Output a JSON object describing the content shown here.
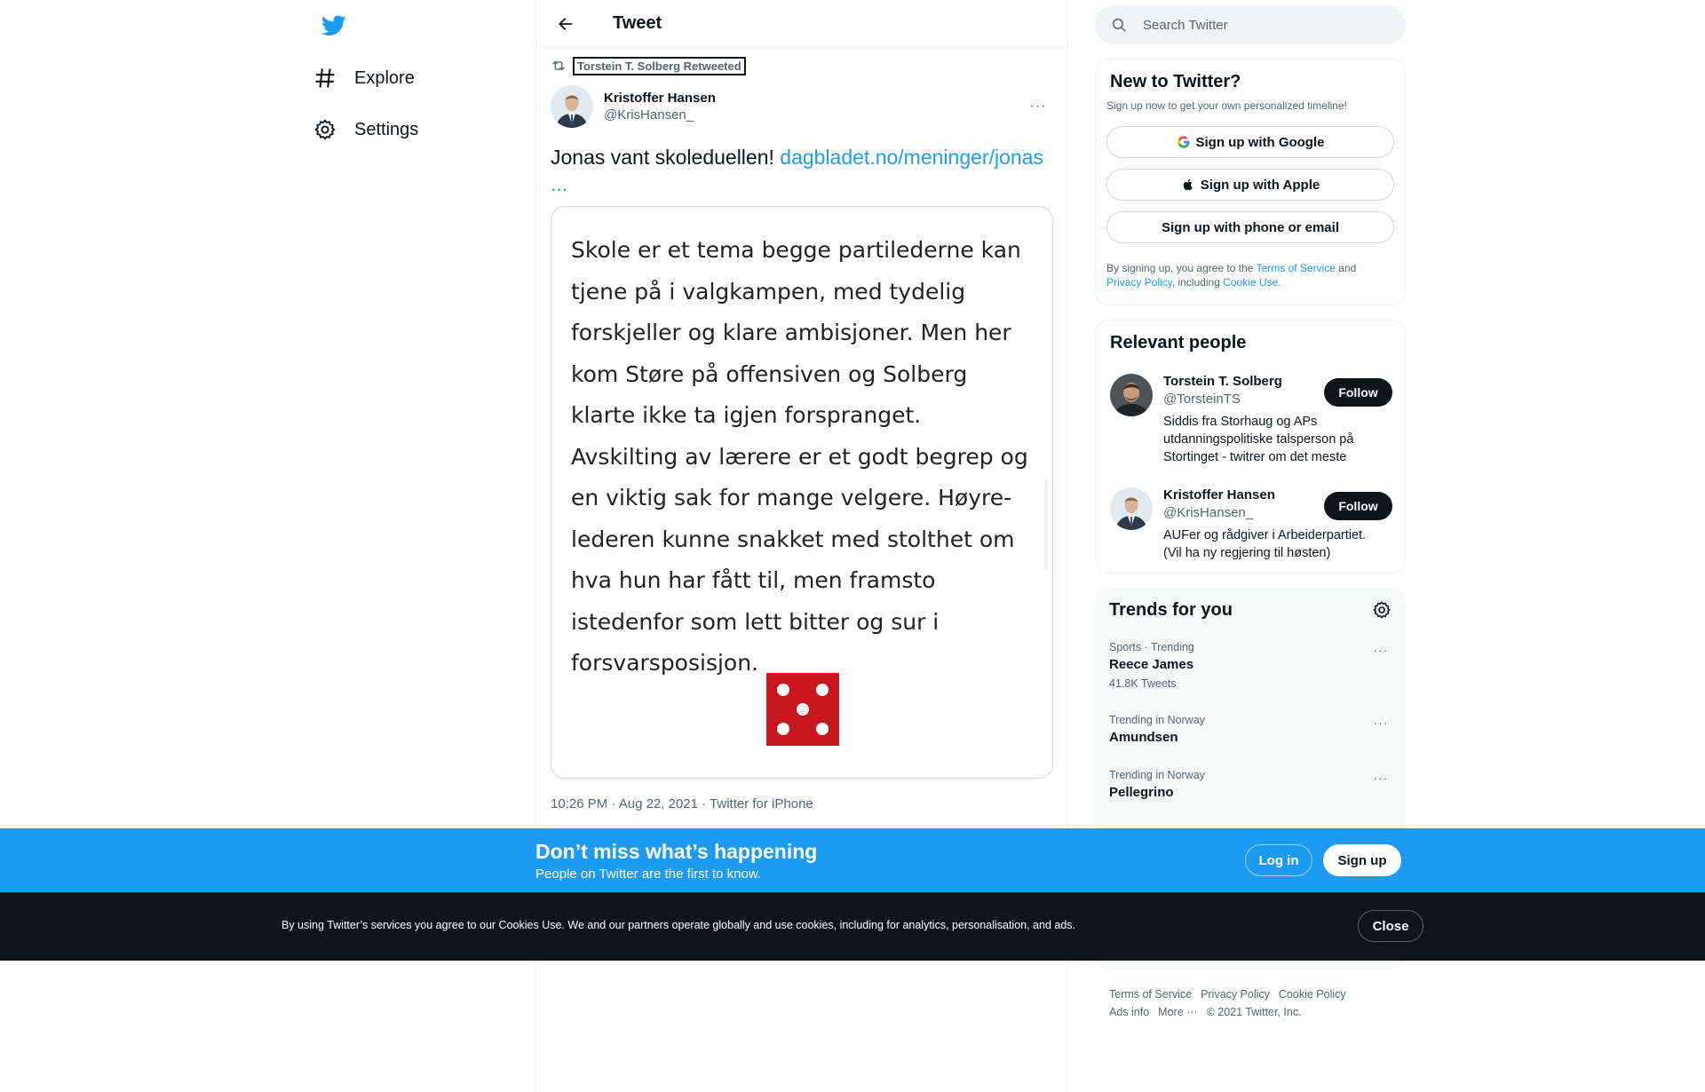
{
  "colors": {
    "accent": "#1d9bf0",
    "text": "#0f1419",
    "muted": "#536471",
    "dark": "#0f1419",
    "border": "#eff3f4"
  },
  "nav": {
    "logo_icon": "twitter-bird-icon",
    "items": [
      {
        "label": "Explore",
        "icon": "hashtag-icon"
      },
      {
        "label": "Settings",
        "icon": "gear-icon"
      }
    ]
  },
  "header": {
    "title": "Tweet",
    "back_icon": "arrow-left-icon"
  },
  "tweet": {
    "retweeted_by": "Torstein T. Solberg Retweeted",
    "author_name": "Kristoffer Hansen",
    "author_handle": "@KrisHansen_",
    "text": "Jonas vant skoleduellen! ",
    "link": "dagbladet.no/meninger/jonas",
    "link_ellipsis": "...",
    "image_text": "Skole er et tema begge partilederne kan tjene på i valgkampen, med tydelig forskjeller og klare ambisjoner. Men her kom Støre på offensiven og Solberg klarte ikke ta igjen forspranget. Avskilting av lærere er et godt begrep og en viktig sak for mange velgere. Høyre-lederen kunne snakket med stolthet om hva hun har fått til, men framsto istedenfor som lett bitter og sur i forsvarsposisjon.",
    "dice_value": 5,
    "time": "10:26 PM",
    "date": "Aug 22, 2021",
    "source": "Twitter for iPhone",
    "sep": " · "
  },
  "search": {
    "placeholder": "Search Twitter"
  },
  "signup": {
    "title": "New to Twitter?",
    "subtitle": "Sign up now to get your own personalized timeline!",
    "google": "Sign up with Google",
    "apple": "Sign up with Apple",
    "phone": "Sign up with phone or email",
    "legal_1": "By signing up, you agree to the ",
    "terms": "Terms of Service",
    "legal_2": " and",
    "privacy": "Privacy Policy",
    "legal_3": ", including ",
    "cookie": "Cookie Use."
  },
  "relevant": {
    "title": "Relevant people",
    "people": [
      {
        "name": "Torstein T. Solberg",
        "handle": "@TorsteinTS",
        "bio": "Siddis fra Storhaug og APs utdanningspolitiske talsperson på Stortinget - twitrer om det meste",
        "follow": "Follow"
      },
      {
        "name": "Kristoffer Hansen",
        "handle": "@KrisHansen_",
        "bio": "AUFer og rådgiver i Arbeiderpartiet. (Vil ha ny regjering til høsten)",
        "follow": "Follow"
      }
    ]
  },
  "trends": {
    "title": "Trends for you",
    "items": [
      {
        "category": "Sports · Trending",
        "name": "Reece James",
        "count": "41.8K Tweets"
      },
      {
        "category": "Trending in Norway",
        "name": "Amundsen",
        "count": ""
      },
      {
        "category": "Trending in Norway",
        "name": "Pellegrino",
        "count": ""
      }
    ]
  },
  "footer": {
    "terms": "Terms of Service",
    "privacy": "Privacy Policy",
    "cookie": "Cookie Policy",
    "ads": "Ads info",
    "more": "More ···",
    "copyright": "© 2021 Twitter, Inc."
  },
  "banner": {
    "title": "Don’t miss what’s happening",
    "subtitle": "People on Twitter are the first to know.",
    "login": "Log in",
    "signup": "Sign up"
  },
  "cookies": {
    "text": "By using Twitter’s services you agree to our Cookies Use. We and our partners operate globally and use cookies, including for analytics, personalisation, and ads.",
    "close": "Close"
  }
}
